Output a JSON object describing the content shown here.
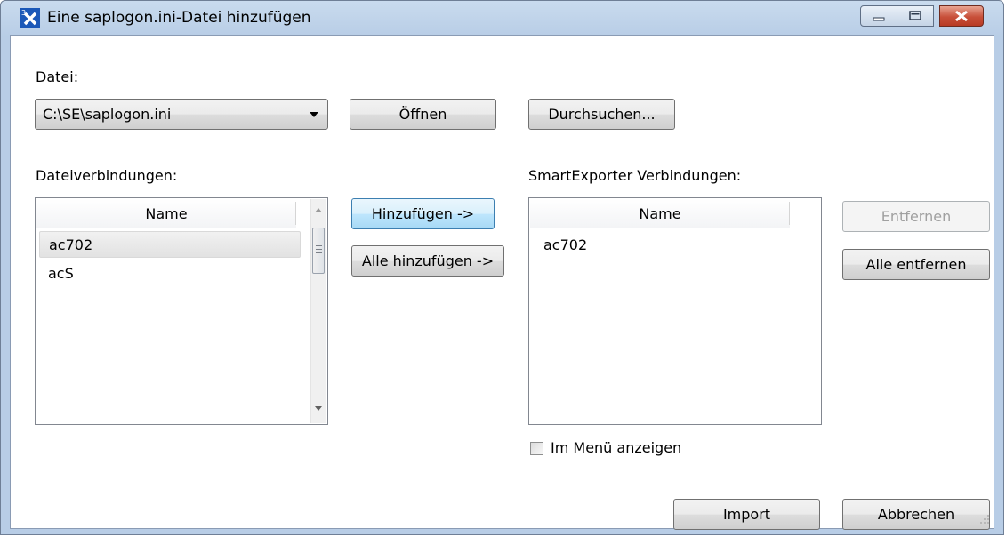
{
  "window": {
    "title": "Eine saplogon.ini-Datei hinzufügen",
    "controls": [
      "minimize-icon",
      "maximize-icon",
      "close-icon"
    ]
  },
  "file": {
    "label": "Datei:",
    "selected_value": "C:\\SE\\saplogon.ini",
    "open_button": "Öffnen",
    "browse_button": "Durchsuchen..."
  },
  "file_connections": {
    "label": "Dateiverbindungen:",
    "column_header": "Name",
    "rows": [
      "ac702",
      "acS"
    ]
  },
  "transfer": {
    "add_button": "Hinzufügen ->",
    "add_all_button": "Alle hinzufügen ->"
  },
  "smartexporter_connections": {
    "label": "SmartExporter Verbindungen:",
    "column_header": "Name",
    "rows": [
      "ac702"
    ],
    "remove_button": "Entfernen",
    "remove_all_button": "Alle entfernen"
  },
  "show_in_menu": {
    "label": "Im Menü anzeigen",
    "checked": false
  },
  "footer": {
    "import_button": "Import",
    "cancel_button": "Abbrechen"
  },
  "colors": {
    "titlebar": "#b8cde6",
    "close_button": "#c8503a",
    "focus_border": "#3c7fb1",
    "disabled_text": "#a0a0a0"
  }
}
